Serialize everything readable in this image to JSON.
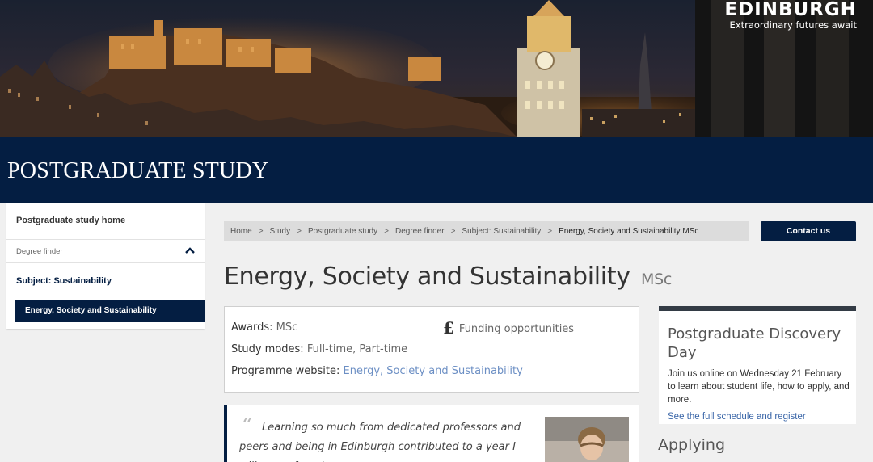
{
  "brand": {
    "name": "EDINBURGH",
    "tagline": "Extraordinary futures await"
  },
  "section_title": "POSTGRADUATE STUDY",
  "sidebar": {
    "home": "Postgraduate study home",
    "finder": "Degree finder",
    "subject": "Subject: Sustainability",
    "active": "Energy, Society and Sustainability"
  },
  "breadcrumb": {
    "items": [
      "Home",
      "Study",
      "Postgraduate study",
      "Degree finder",
      "Subject: Sustainability"
    ],
    "current": "Energy, Society and Sustainability MSc",
    "separator": ">"
  },
  "contact_label": "Contact us",
  "page": {
    "title": "Energy, Society and Sustainability",
    "award": "MSc"
  },
  "info": {
    "awards_label": "Awards:",
    "awards_value": "MSc",
    "modes_label": "Study modes:",
    "modes_value": "Full-time, Part-time",
    "website_label": "Programme website:",
    "website_value": "Energy, Society and Sustainability",
    "funding_label": "Funding opportunities",
    "pound_symbol": "£"
  },
  "quote": {
    "mark": "“",
    "text": "Learning so much from dedicated professors and peers and being in Edinburgh contributed to a year I will never forget"
  },
  "promo": {
    "title": "Postgraduate Discovery Day",
    "body": "Join us online on Wednesday 21 February to learn about student life, how to apply, and more.",
    "link": "See the full schedule and register"
  },
  "applying_heading": "Applying",
  "colors": {
    "navy": "#041e42",
    "link": "#6c8fc4",
    "promo_link": "#3a66a8"
  }
}
